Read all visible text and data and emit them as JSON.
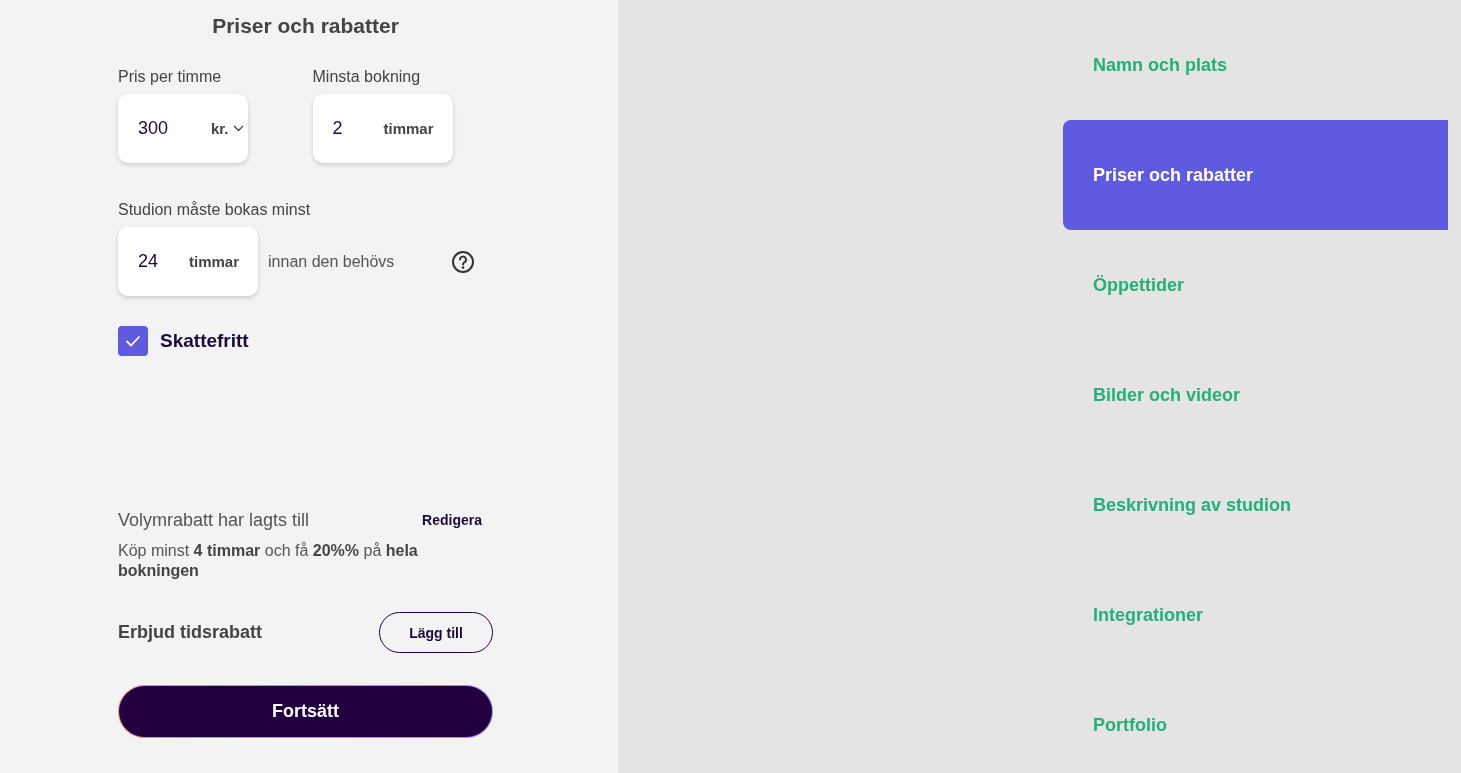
{
  "form": {
    "title": "Priser och rabatter",
    "fields": [
      {
        "label": "Pris per timme",
        "value": "300",
        "unit": "kr.",
        "kind": "dropdown"
      },
      {
        "label": "Minsta bokning",
        "value": "2",
        "unit": "timmar",
        "kind": "plain"
      }
    ],
    "advance": {
      "label": "Studion måste bokas minst",
      "value": "24",
      "unit": "timmar",
      "suffix": "innan den behövs"
    },
    "tax_free": {
      "label": "Skattefritt",
      "checked": true
    },
    "volume_discount": {
      "title": "Volymrabatt har lagts till",
      "edit_link": "Redigera",
      "description": "Köp minst **4 timmar** och få **20%%** på **hela bokningen**"
    },
    "time_discount": {
      "label": "Erbjud tidsrabatt",
      "button": "Lägg till"
    },
    "continue_button": "Fortsätt"
  },
  "steps": [
    {
      "label": "Namn och plats",
      "selected": false
    },
    {
      "label": "Priser och rabatter",
      "selected": true
    },
    {
      "label": "Öppettider",
      "selected": false
    },
    {
      "label": "Bilder och videor",
      "selected": false
    },
    {
      "label": "Beskrivning av studion",
      "selected": false
    },
    {
      "label": "Integrationer",
      "selected": false
    },
    {
      "label": "Portfolio",
      "selected": false
    }
  ]
}
